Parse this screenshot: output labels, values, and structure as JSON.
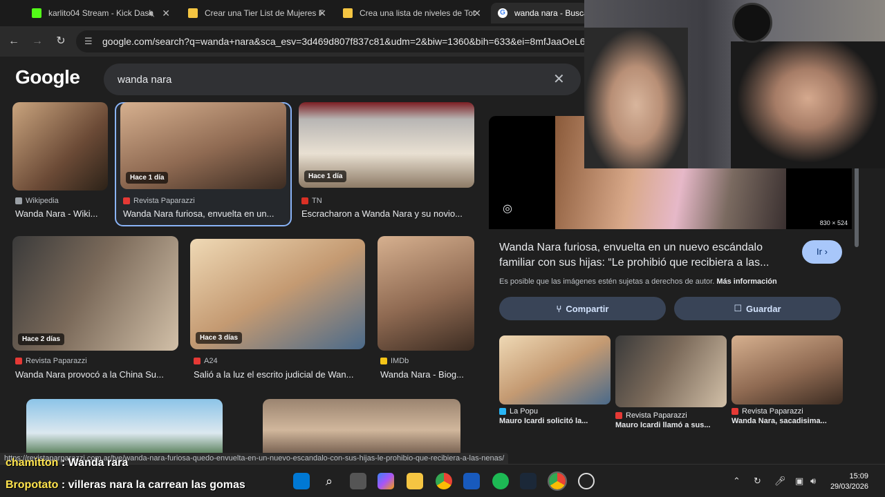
{
  "tabs": [
    {
      "title": "karlito04 Stream - Kick Dash",
      "favicon_color": "#53fc18",
      "active": false
    },
    {
      "title": "Crear una Tier List de Mujeres F",
      "favicon_color": "#f4c542",
      "active": false
    },
    {
      "title": "Crea una lista de niveles de Tot",
      "favicon_color": "#f4c542",
      "active": false
    },
    {
      "title": "wanda nara - Buscar c",
      "favicon_color": "#4285f4",
      "active": true
    }
  ],
  "toolbar": {
    "url": "google.com/search?q=wanda+nara&sca_esv=3d469d807f837c81&udm=2&biw=1360&bih=633&ei=8mfJaaOeL6XF5OU"
  },
  "google": {
    "logo": "Google",
    "query": "wanda nara"
  },
  "results": [
    {
      "source": "Wikipedia",
      "title": "Wanda Nara - Wiki...",
      "badge": "",
      "fav": "#9aa0a6"
    },
    {
      "source": "Revista Paparazzi",
      "title": "Wanda Nara furiosa, envuelta en un...",
      "badge": "Hace 1 día",
      "fav": "#e53935"
    },
    {
      "source": "TN",
      "title": "Escracharon a Wanda Nara y su novio...",
      "badge": "Hace 1 día",
      "fav": "#d93025"
    },
    {
      "source": "Revista Paparazzi",
      "title": "Wanda Nara provocó a la China Su...",
      "badge": "Hace 2 días",
      "fav": "#e53935"
    },
    {
      "source": "A24",
      "title": "Salió a la luz el escrito judicial de Wan...",
      "badge": "Hace 3 días",
      "fav": "#e53935"
    },
    {
      "source": "IMDb",
      "title": "Wanda Nara - Biog...",
      "badge": "",
      "fav": "#f5c518"
    }
  ],
  "panel": {
    "dimensions": "830 × 524",
    "title": "Wanda Nara furiosa, envuelta en un nuevo escándalo familiar con sus hijas: “Le prohibió que recibiera a las...",
    "go_label": "Ir",
    "copyright_text": "Es posible que las imágenes estén sujetas a derechos de autor.",
    "copyright_link": "Más información",
    "share_label": "Compartir",
    "save_label": "Guardar",
    "related": [
      {
        "source": "La Popu",
        "title": "Mauro Icardi solicitó la..."
      },
      {
        "source": "Revista Paparazzi",
        "title": "Mauro Icardi llamó a sus..."
      },
      {
        "source": "Revista Paparazzi",
        "title": "Wanda Nara, sacadisima..."
      }
    ]
  },
  "status_url": "https://revistaparparazzi.com.ar/tve/wanda-nara-furiosa-quedo-envuelta-en-un-nuevo-escandalo-con-sus-hijas-le-prohibio-que-recibiera-a-las-nenas/",
  "chat": [
    {
      "user": "chamitton",
      "message": "Wanda rara"
    },
    {
      "user": "Bropotato",
      "message": "villeras nara la carrean las gomas"
    }
  ],
  "taskbar": {
    "time": "15:09",
    "date": "29/03/2026"
  }
}
